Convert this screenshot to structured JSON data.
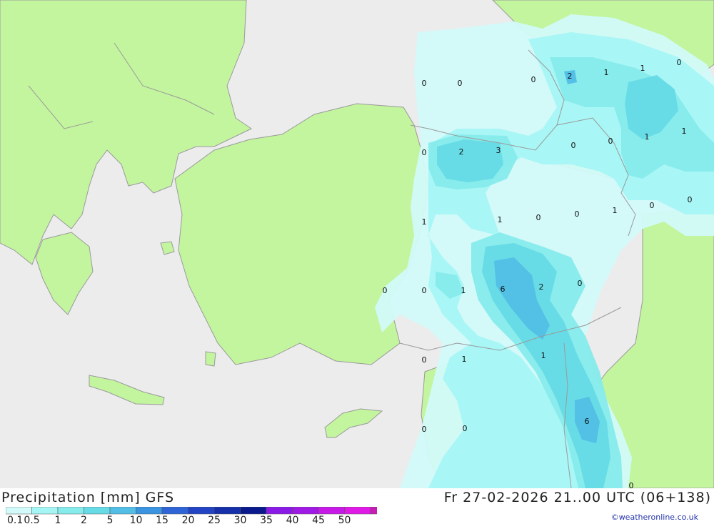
{
  "header": {
    "title": "Precipitation [mm] GFS",
    "datetime": "Fr 27-02-2026 21..00 UTC (06+138)"
  },
  "credit": "©weatheronline.co.uk",
  "legend": {
    "colors": [
      "#d2fafa",
      "#a6f5f5",
      "#86ebeb",
      "#66dbe6",
      "#52bee6",
      "#3a94e0",
      "#2e64d6",
      "#2244c4",
      "#1530a8",
      "#0a1a8c",
      "#8a1ae6",
      "#a01ae6",
      "#c81ae6",
      "#e01ae6",
      "#c81ab4",
      "#a0148c"
    ],
    "labels": [
      "0.1",
      "0.5",
      "1",
      "2",
      "5",
      "10",
      "15",
      "20",
      "25",
      "30",
      "35",
      "40",
      "45",
      "50"
    ]
  },
  "map_values": [
    {
      "text": "0"
    },
    {
      "text": "0"
    },
    {
      "text": "0"
    },
    {
      "text": "2"
    },
    {
      "text": "1"
    },
    {
      "text": "1"
    },
    {
      "text": "0"
    },
    {
      "text": "0"
    },
    {
      "text": "2"
    },
    {
      "text": "3"
    },
    {
      "text": "0"
    },
    {
      "text": "0"
    },
    {
      "text": "1"
    },
    {
      "text": "1"
    },
    {
      "text": "1"
    },
    {
      "text": "1"
    },
    {
      "text": "0"
    },
    {
      "text": "0"
    },
    {
      "text": "1"
    },
    {
      "text": "0"
    },
    {
      "text": "0"
    },
    {
      "text": "0"
    },
    {
      "text": "0"
    },
    {
      "text": "1"
    },
    {
      "text": "6"
    },
    {
      "text": "2"
    },
    {
      "text": "0"
    },
    {
      "text": "0"
    },
    {
      "text": "1"
    },
    {
      "text": "1"
    },
    {
      "text": "6"
    },
    {
      "text": "0"
    },
    {
      "text": "0"
    },
    {
      "text": "0"
    }
  ]
}
